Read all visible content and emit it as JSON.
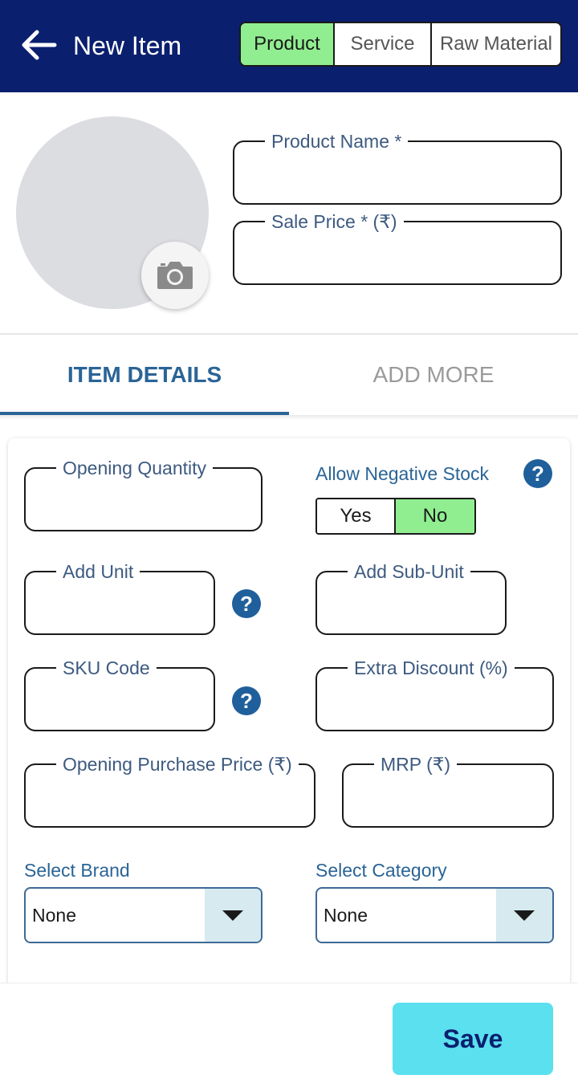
{
  "header": {
    "title": "New Item",
    "item_types": [
      {
        "label": "Product",
        "active": true
      },
      {
        "label": "Service",
        "active": false
      },
      {
        "label": "Raw Material",
        "active": false
      }
    ]
  },
  "top_fields": {
    "product_name_label": "Product Name *",
    "sale_price_label": "Sale Price * (₹)"
  },
  "tabs": [
    {
      "label": "ITEM DETAILS",
      "active": true
    },
    {
      "label": "ADD MORE",
      "active": false
    }
  ],
  "details": {
    "opening_quantity_label": "Opening Quantity",
    "allow_negative_stock_label": "Allow Negative Stock",
    "negative_stock_options": [
      "Yes",
      "No"
    ],
    "negative_stock_selected": "No",
    "add_unit_label": "Add Unit",
    "add_sub_unit_label": "Add Sub-Unit",
    "sku_code_label": "SKU Code",
    "extra_discount_label": "Extra Discount (%)",
    "opening_purchase_price_label": "Opening Purchase Price (₹)",
    "mrp_label": "MRP (₹)",
    "select_brand_label": "Select Brand",
    "brand_value": "None",
    "select_category_label": "Select Category",
    "category_value": "None",
    "help_glyph": "?"
  },
  "footer": {
    "save_label": "Save"
  },
  "colors": {
    "header_bg": "#0a1f6e",
    "active_toggle": "#90ee90",
    "accent_blue": "#2a6496",
    "save_bg": "#5ae0ee"
  },
  "icons": [
    "back-arrow-icon",
    "camera-icon",
    "help-icon",
    "chevron-down-icon"
  ]
}
